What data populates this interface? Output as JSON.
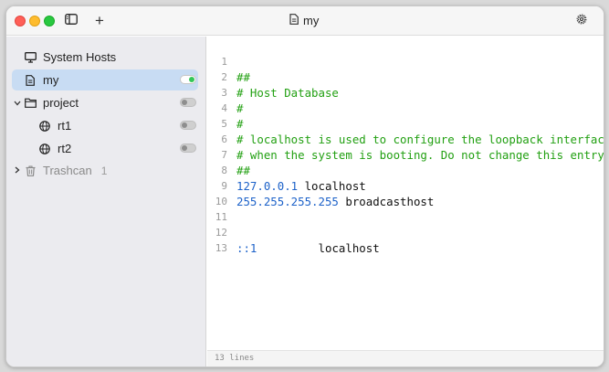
{
  "window": {
    "title": "my",
    "sidebar_toggle_icon": "sidebar-icon",
    "add_icon": "plus-icon",
    "settings_icon": "gear-icon"
  },
  "sidebar": {
    "items": [
      {
        "label": "System Hosts",
        "icon": "monitor-icon"
      },
      {
        "label": "my",
        "icon": "file-icon",
        "selected": true,
        "enabled": true
      },
      {
        "label": "project",
        "icon": "folder-icon",
        "expanded": true,
        "enabled": false
      },
      {
        "label": "rt1",
        "icon": "globe-icon",
        "enabled": false
      },
      {
        "label": "rt2",
        "icon": "globe-icon",
        "enabled": false
      },
      {
        "label": "Trashcan",
        "icon": "trash-icon",
        "count": "1",
        "expanded": false
      }
    ]
  },
  "editor": {
    "lines": [
      {
        "num": "1",
        "text": "##"
      },
      {
        "num": "2",
        "text": "# Host Database"
      },
      {
        "num": "3",
        "text": "#"
      },
      {
        "num": "4",
        "text": "#"
      },
      {
        "num": "5",
        "text": "# localhost is used to configure the loopback interface"
      },
      {
        "num": "6",
        "text": "# when the system is booting. Do not change this entry."
      },
      {
        "num": "7",
        "text": "##"
      },
      {
        "num": "8",
        "ip": "127.0.0.1",
        "host": " localhost"
      },
      {
        "num": "9",
        "ip": "255.255.255.255",
        "host": " broadcasthost"
      },
      {
        "num": "10",
        "text": ""
      },
      {
        "num": "11",
        "text": ""
      },
      {
        "num": "12",
        "ip": "::1",
        "host": "         localhost"
      },
      {
        "num": "13",
        "text": ""
      }
    ],
    "status": "13 lines"
  },
  "colors": {
    "comment": "#22a012",
    "ip": "#1d62c9",
    "selection": "#c8dcf3",
    "toggle_on": "#34c759"
  }
}
